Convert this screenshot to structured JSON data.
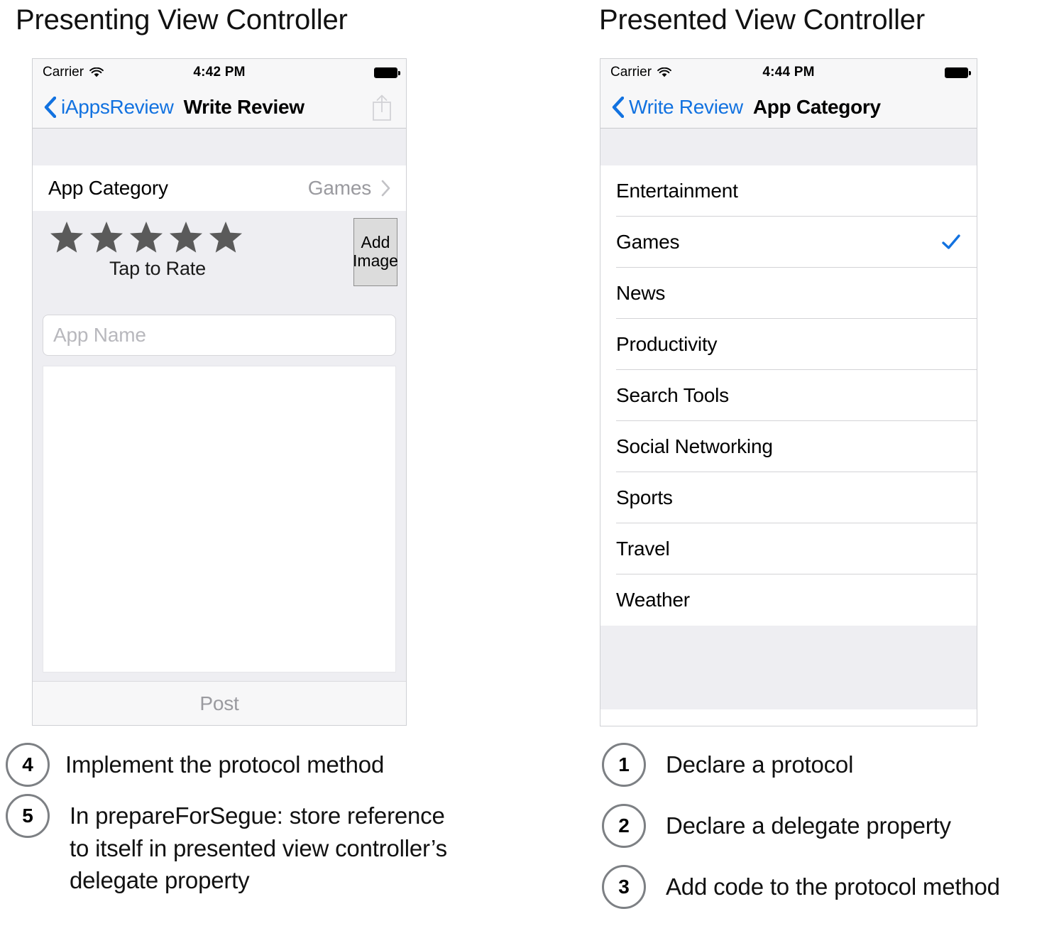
{
  "left": {
    "title": "Presenting View Controller",
    "status": {
      "carrier": "Carrier",
      "time": "4:42 PM",
      "wifi_icon": "wifi-icon",
      "battery_icon": "battery-icon"
    },
    "nav": {
      "back_icon": "chevron-left-icon",
      "back_label": "iAppsReview",
      "title": "Write Review",
      "action_icon": "share-icon"
    },
    "category_row": {
      "label": "App Category",
      "value": "Games",
      "disclosure_icon": "chevron-right-icon"
    },
    "rating": {
      "stars": 5,
      "caption": "Tap to Rate",
      "star_icon": "star-icon",
      "star_color": "#5a5a5a"
    },
    "add_image_button": {
      "line1": "Add",
      "line2": "Image"
    },
    "app_name_field": {
      "placeholder": "App Name",
      "value": ""
    },
    "review_textview": {
      "value": ""
    },
    "post_button": {
      "label": "Post"
    }
  },
  "right": {
    "title": "Presented View Controller",
    "status": {
      "carrier": "Carrier",
      "time": "4:44 PM",
      "wifi_icon": "wifi-icon",
      "battery_icon": "battery-icon"
    },
    "nav": {
      "back_icon": "chevron-left-icon",
      "back_label": "Write Review",
      "title": "App Category"
    },
    "categories": [
      {
        "label": "Entertainment",
        "selected": false
      },
      {
        "label": "Games",
        "selected": true
      },
      {
        "label": "News",
        "selected": false
      },
      {
        "label": "Productivity",
        "selected": false
      },
      {
        "label": "Search Tools",
        "selected": false
      },
      {
        "label": "Social Networking",
        "selected": false
      },
      {
        "label": "Sports",
        "selected": false
      },
      {
        "label": "Travel",
        "selected": false
      },
      {
        "label": "Weather",
        "selected": false
      }
    ],
    "checkmark_icon": "checkmark-icon",
    "accent_color": "#1272e0"
  },
  "notes_left": [
    {
      "number": "4",
      "text": "Implement the protocol method"
    },
    {
      "number": "5",
      "text": " In prepareForSegue: store reference\nto itself in presented view controller’s\ndelegate property"
    }
  ],
  "notes_right": [
    {
      "number": "1",
      "text": "Declare a protocol"
    },
    {
      "number": "2",
      "text": "Declare a delegate property"
    },
    {
      "number": "3",
      "text": "Add code to the protocol method"
    }
  ]
}
